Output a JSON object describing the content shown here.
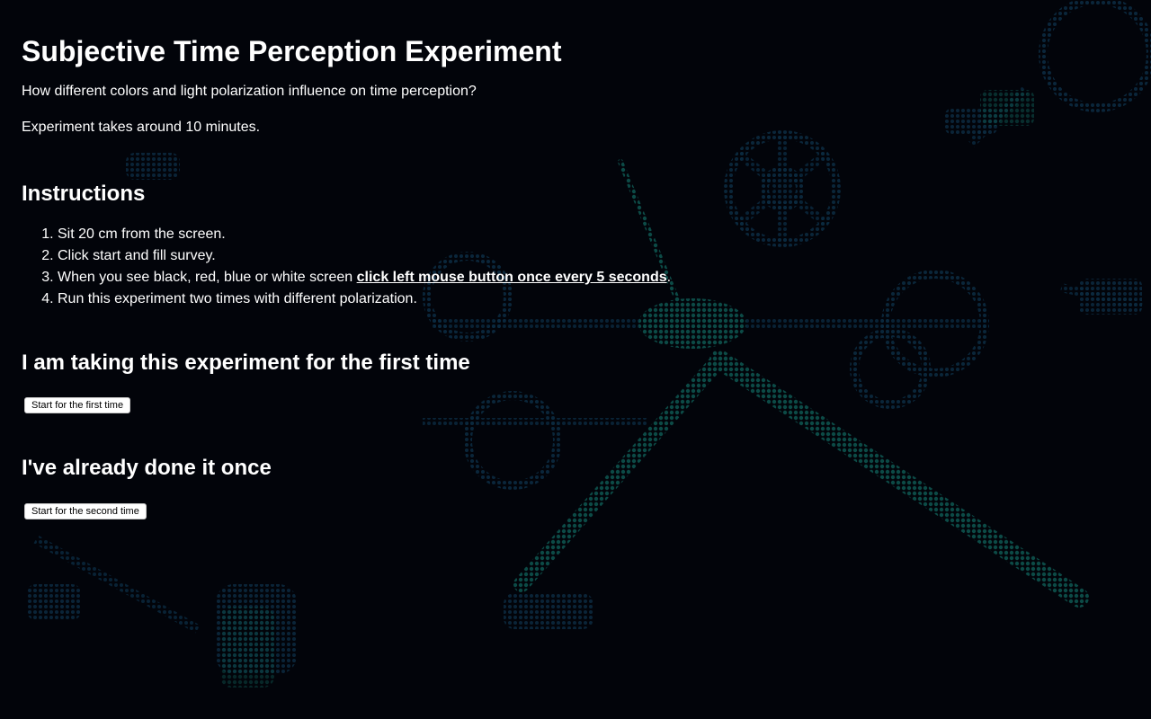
{
  "page": {
    "title": "Subjective Time Perception Experiment",
    "description": "How different colors and light polarization influence on time perception?",
    "duration": "Experiment takes around 10 minutes."
  },
  "instructions": {
    "heading": "Instructions",
    "items": [
      "Sit 20 cm from the screen.",
      "Click start and fill survey.",
      "When you see black, red, blue or white screen ",
      "Run this experiment two times with different polarization."
    ],
    "emphasis": "click left mouse button once every 5 seconds",
    "emphasis_suffix": "."
  },
  "first_time": {
    "heading": "I am taking this experiment for the first time",
    "button_label": "Start for the first time"
  },
  "second_time": {
    "heading": "I've already done it once",
    "button_label": "Start for the second time"
  },
  "colors": {
    "background": "#02040a",
    "text": "#ffffff",
    "background_pattern": "#0a4a45"
  }
}
